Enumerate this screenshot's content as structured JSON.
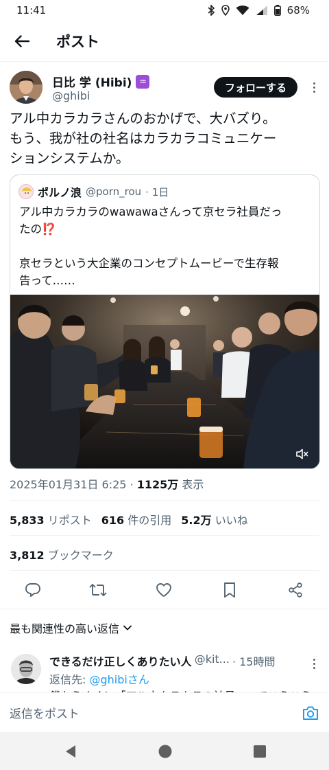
{
  "status_bar": {
    "time": "11:41",
    "battery": "68%"
  },
  "header": {
    "title": "ポスト"
  },
  "author": {
    "name": "日比 学 (Hibi)",
    "zodiac_badge": "♒",
    "handle": "@ghibi",
    "follow_label": "フォローする"
  },
  "post": {
    "lines": [
      "アル中カラカラさんのおかげで、大バズり。",
      "もう、我が社の社名はカラカラコミュニケー",
      "ションシステムか。"
    ]
  },
  "quote": {
    "name": "ポルノ浪",
    "handle": "@porn_rou",
    "time": "· 1日",
    "lines": [
      "アル中カラカラのwawawaさんって京セラ社員だっ",
      "たの⁉️",
      "",
      "京セラという大企業のコンセプトムービーで生存報",
      "告って……"
    ]
  },
  "meta": {
    "date": "2025年01月31日 6:25",
    "separator": "·",
    "views_count": "1125万",
    "views_label": "表示"
  },
  "stats": {
    "reposts_count": "5,833",
    "reposts_label": "リポスト",
    "quotes_count": "616",
    "quotes_label": "件の引用",
    "likes_count": "5.2万",
    "likes_label": "いいね",
    "bookmarks_count": "3,812",
    "bookmarks_label": "ブックマーク"
  },
  "replies": {
    "sort_label": "最も関連性の高い返信",
    "items": [
      {
        "name": "できるだけ正しくありたい人",
        "handle": "@kit...",
        "time": "· 15時間",
        "reply_to_label": "返信先:",
        "reply_to_handle": "@ghibiさん",
        "text": "僕もうすくに「アル中カラカラの社員」ってこうこう"
      }
    ]
  },
  "composer": {
    "placeholder": "返信をポスト"
  },
  "colors": {
    "accent": "#1d9bf0",
    "text": "#0f1419",
    "secondary": "#536471",
    "border": "#cfd9de"
  }
}
